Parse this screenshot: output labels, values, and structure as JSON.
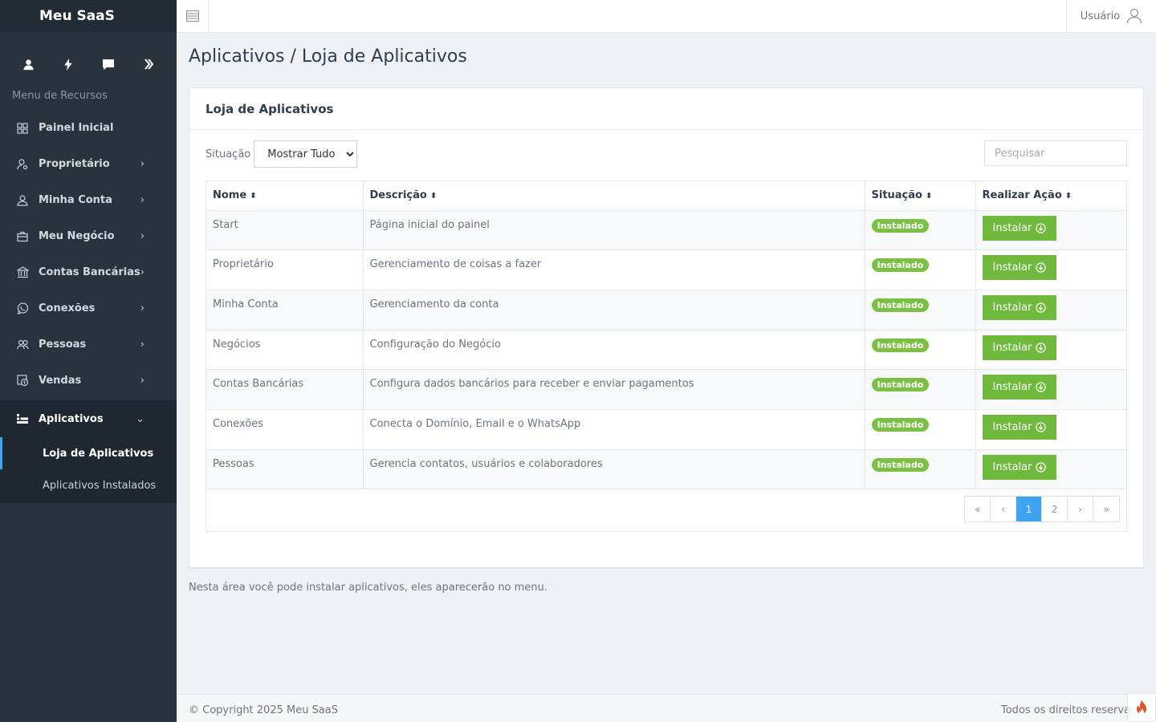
{
  "brand": "Meu SaaS",
  "sidebar": {
    "menu_title": "Menu de Recursos",
    "items": [
      {
        "label": "Painel Inicial"
      },
      {
        "label": "Proprietário"
      },
      {
        "label": "Minha Conta"
      },
      {
        "label": "Meu Negócio"
      },
      {
        "label": "Contas Bancárias"
      },
      {
        "label": "Conexões"
      },
      {
        "label": "Pessoas"
      },
      {
        "label": "Vendas"
      },
      {
        "label": "Aplicativos"
      }
    ],
    "submenu": [
      {
        "label": "Loja de Aplicativos"
      },
      {
        "label": "Aplicativos Instalados"
      }
    ],
    "chevron": "›",
    "chevron_open": "⌄"
  },
  "topbar": {
    "user_label": "Usuário"
  },
  "page": {
    "title": "Aplicativos / Loja de Aplicativos"
  },
  "card": {
    "title": "Loja de Aplicativos",
    "filter_label": "Situação",
    "filter_value": "Mostrar Tudo",
    "search_placeholder": "Pesquisar"
  },
  "table": {
    "headers": [
      "Nome",
      "Descrição",
      "Situação",
      "Realizar Ação"
    ],
    "sort_glyph": "⬍",
    "rows": [
      {
        "name": "Start",
        "desc": "Página inicial do painel",
        "status": "Instalado",
        "action": "Instalar"
      },
      {
        "name": "Proprietário",
        "desc": "Gerenciamento de coisas a fazer",
        "status": "Instalado",
        "action": "Instalar"
      },
      {
        "name": "Minha Conta",
        "desc": "Gerenciamento da conta",
        "status": "Instalado",
        "action": "Instalar"
      },
      {
        "name": "Negócios",
        "desc": "Configuração do Negócio",
        "status": "Instalado",
        "action": "Instalar"
      },
      {
        "name": "Contas Bancárias",
        "desc": "Configura dados bancários para receber e enviar pagamentos",
        "status": "Instalado",
        "action": "Instalar"
      },
      {
        "name": "Conexões",
        "desc": "Conecta o Domínio, Email e o WhatsApp",
        "status": "Instalado",
        "action": "Instalar"
      },
      {
        "name": "Pessoas",
        "desc": "Gerencia contatos, usuários e colaboradores",
        "status": "Instalado",
        "action": "Instalar"
      }
    ]
  },
  "pager": {
    "first": "«",
    "prev": "‹",
    "pages": [
      "1",
      "2"
    ],
    "current": "1",
    "next": "›",
    "last": "»"
  },
  "note": "Nesta área você pode instalar aplicativos, eles aparecerão no menu.",
  "footer": {
    "copyright": "© Copyright 2025 Meu SaaS",
    "rights": "Todos os direitos reservados"
  },
  "colors": {
    "sidebar": "#28333d",
    "accent": "#3fa4f0",
    "success": "#6fba3c"
  }
}
